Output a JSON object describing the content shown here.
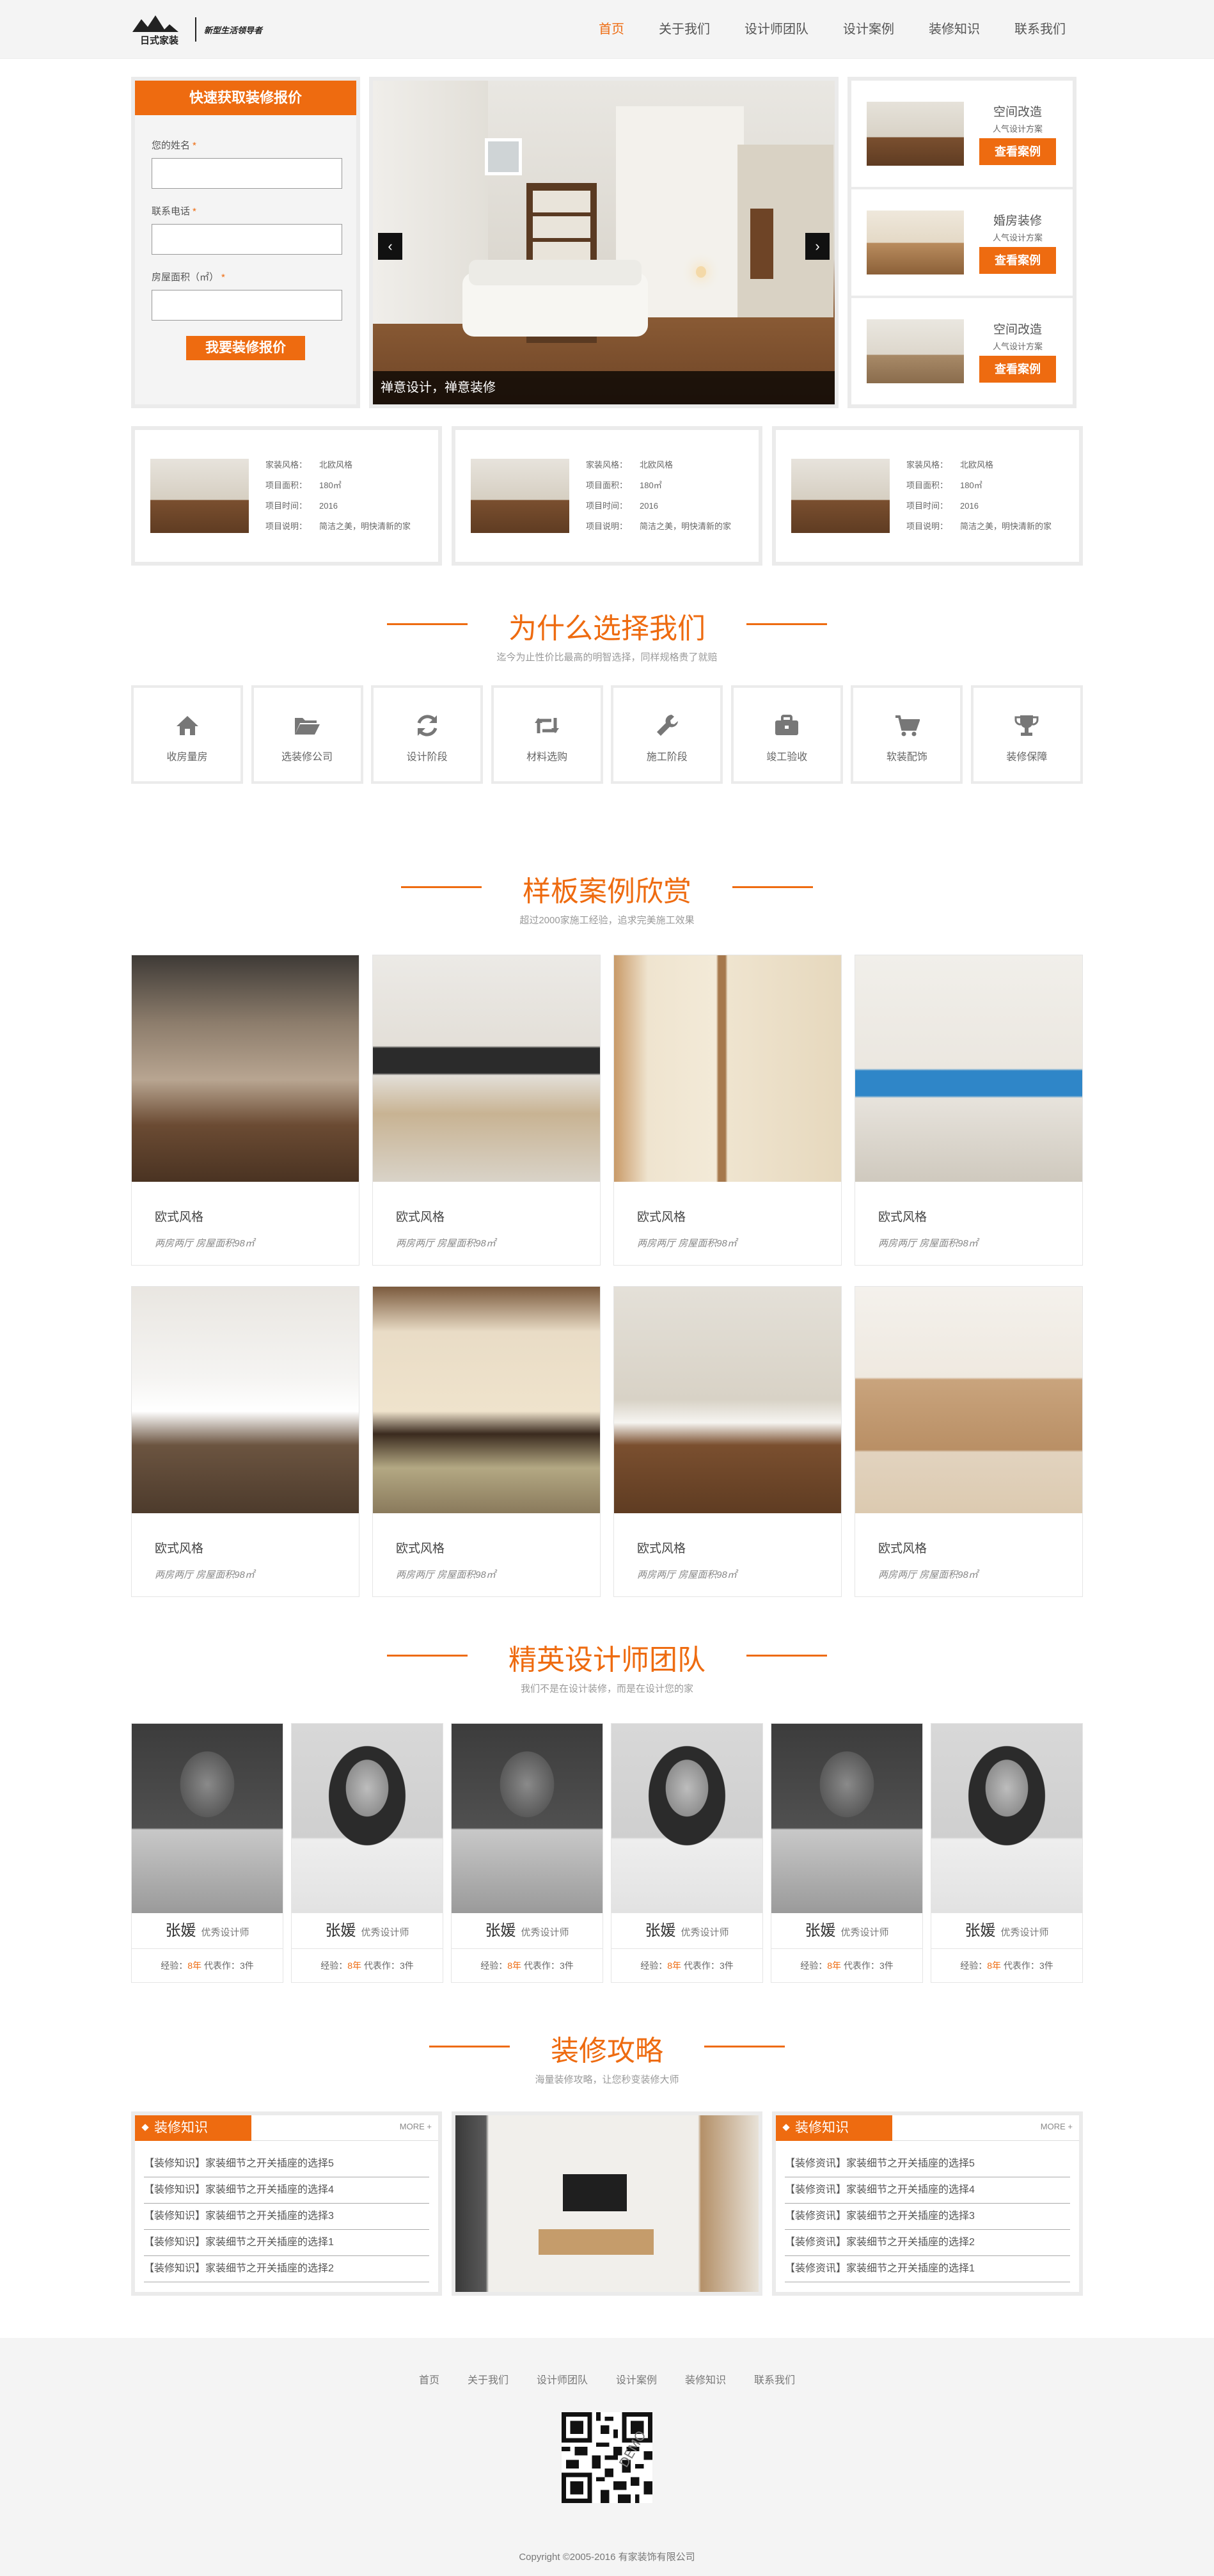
{
  "header": {
    "logo_text": "日式家装",
    "slogan": "新型生活领导者",
    "nav": [
      "首页",
      "关于我们",
      "设计师团队",
      "设计案例",
      "装修知识",
      "联系我们"
    ],
    "active_nav": "首页"
  },
  "quote_form": {
    "title": "快速获取装修报价",
    "name_label": "您的姓名",
    "phone_label": "联系电话",
    "area_label": "房屋面积（㎡）",
    "required_mark": "*",
    "submit": "我要装修报价"
  },
  "slider": {
    "caption": "禅意设计，禅意装修",
    "prev": "‹",
    "next": "›"
  },
  "side_cases": [
    {
      "title": "空间改造",
      "sub": "人气设计方案",
      "button": "查看案例"
    },
    {
      "title": "婚房装修",
      "sub": "人气设计方案",
      "button": "查看案例"
    },
    {
      "title": "空间改造",
      "sub": "人气设计方案",
      "button": "查看案例"
    }
  ],
  "projects": [
    {
      "style_k": "家装风格：",
      "style_v": "北欧风格",
      "area_k": "项目面积：",
      "area_v": "180㎡",
      "time_k": "项目时间：",
      "time_v": "2016",
      "desc_k": "项目说明：",
      "desc_v": "简洁之美，明快清新的家"
    },
    {
      "style_k": "家装风格：",
      "style_v": "北欧风格",
      "area_k": "项目面积：",
      "area_v": "180㎡",
      "time_k": "项目时间：",
      "time_v": "2016",
      "desc_k": "项目说明：",
      "desc_v": "简洁之美，明快清新的家"
    },
    {
      "style_k": "家装风格：",
      "style_v": "北欧风格",
      "area_k": "项目面积：",
      "area_v": "180㎡",
      "time_k": "项目时间：",
      "time_v": "2016",
      "desc_k": "项目说明：",
      "desc_v": "简洁之美，明快清新的家"
    }
  ],
  "why": {
    "title": "为什么选择我们",
    "subtitle": "迄今为止性价比最高的明智选择，同样规格贵了就赔",
    "items": [
      {
        "label": "收房量房",
        "icon": "home-icon"
      },
      {
        "label": "选装修公司",
        "icon": "folder-icon"
      },
      {
        "label": "设计阶段",
        "icon": "refresh-icon"
      },
      {
        "label": "材料选购",
        "icon": "retweet-icon"
      },
      {
        "label": "施工阶段",
        "icon": "wrench-icon"
      },
      {
        "label": "竣工验收",
        "icon": "briefcase-icon"
      },
      {
        "label": "软装配饰",
        "icon": "cart-icon"
      },
      {
        "label": "装修保障",
        "icon": "trophy-icon"
      }
    ]
  },
  "cases": {
    "title": "样板案例欣赏",
    "subtitle": "超过2000家施工经验，追求完美施工效果",
    "items": [
      {
        "name": "欧式风格",
        "desc": "两房两厅 房屋面积98㎡"
      },
      {
        "name": "欧式风格",
        "desc": "两房两厅 房屋面积98㎡"
      },
      {
        "name": "欧式风格",
        "desc": "两房两厅 房屋面积98㎡"
      },
      {
        "name": "欧式风格",
        "desc": "两房两厅 房屋面积98㎡"
      },
      {
        "name": "欧式风格",
        "desc": "两房两厅 房屋面积98㎡"
      },
      {
        "name": "欧式风格",
        "desc": "两房两厅 房屋面积98㎡"
      },
      {
        "name": "欧式风格",
        "desc": "两房两厅 房屋面积98㎡"
      },
      {
        "name": "欧式风格",
        "desc": "两房两厅 房屋面积98㎡"
      }
    ]
  },
  "team": {
    "title": "精英设计师团队",
    "subtitle": "我们不是在设计装修，而是在设计您的家",
    "members": [
      {
        "name": "张媛",
        "role": "优秀设计师",
        "exp_k": "经验：",
        "exp_v": "8年",
        "works_k": "代表作：",
        "works_v": "3件",
        "gender": "m"
      },
      {
        "name": "张媛",
        "role": "优秀设计师",
        "exp_k": "经验：",
        "exp_v": "8年",
        "works_k": "代表作：",
        "works_v": "3件",
        "gender": "f"
      },
      {
        "name": "张媛",
        "role": "优秀设计师",
        "exp_k": "经验：",
        "exp_v": "8年",
        "works_k": "代表作：",
        "works_v": "3件",
        "gender": "m"
      },
      {
        "name": "张媛",
        "role": "优秀设计师",
        "exp_k": "经验：",
        "exp_v": "8年",
        "works_k": "代表作：",
        "works_v": "3件",
        "gender": "f"
      },
      {
        "name": "张媛",
        "role": "优秀设计师",
        "exp_k": "经验：",
        "exp_v": "8年",
        "works_k": "代表作：",
        "works_v": "3件",
        "gender": "m"
      },
      {
        "name": "张媛",
        "role": "优秀设计师",
        "exp_k": "经验：",
        "exp_v": "8年",
        "works_k": "代表作：",
        "works_v": "3件",
        "gender": "f"
      }
    ]
  },
  "guide": {
    "title": "装修攻略",
    "subtitle": "海量装修攻略，让您秒变装修大师",
    "left": {
      "tab": "装修知识",
      "more": "MORE +",
      "items": [
        "【装修知识】家装细节之开关插座的选择5",
        "【装修知识】家装细节之开关插座的选择4",
        "【装修知识】家装细节之开关插座的选择3",
        "【装修知识】家装细节之开关插座的选择1",
        "【装修知识】家装细节之开关插座的选择2"
      ]
    },
    "right": {
      "tab": "装修知识",
      "more": "MORE +",
      "items": [
        "【装修资讯】家装细节之开关插座的选择5",
        "【装修资讯】家装细节之开关插座的选择4",
        "【装修资讯】家装细节之开关插座的选择3",
        "【装修资讯】家装细节之开关插座的选择2",
        "【装修资讯】家装细节之开关插座的选择1"
      ]
    }
  },
  "footer": {
    "nav": [
      "首页",
      "关于我们",
      "设计师团队",
      "设计案例",
      "装修知识",
      "联系我们"
    ],
    "qr_watermark": "DEMO",
    "copyright": "Copyright ©2005-2016 有家装饰有限公司"
  },
  "colors": {
    "accent": "#ee6b10",
    "footer_bg": "#f4f4f4",
    "border": "#ebebeb"
  }
}
